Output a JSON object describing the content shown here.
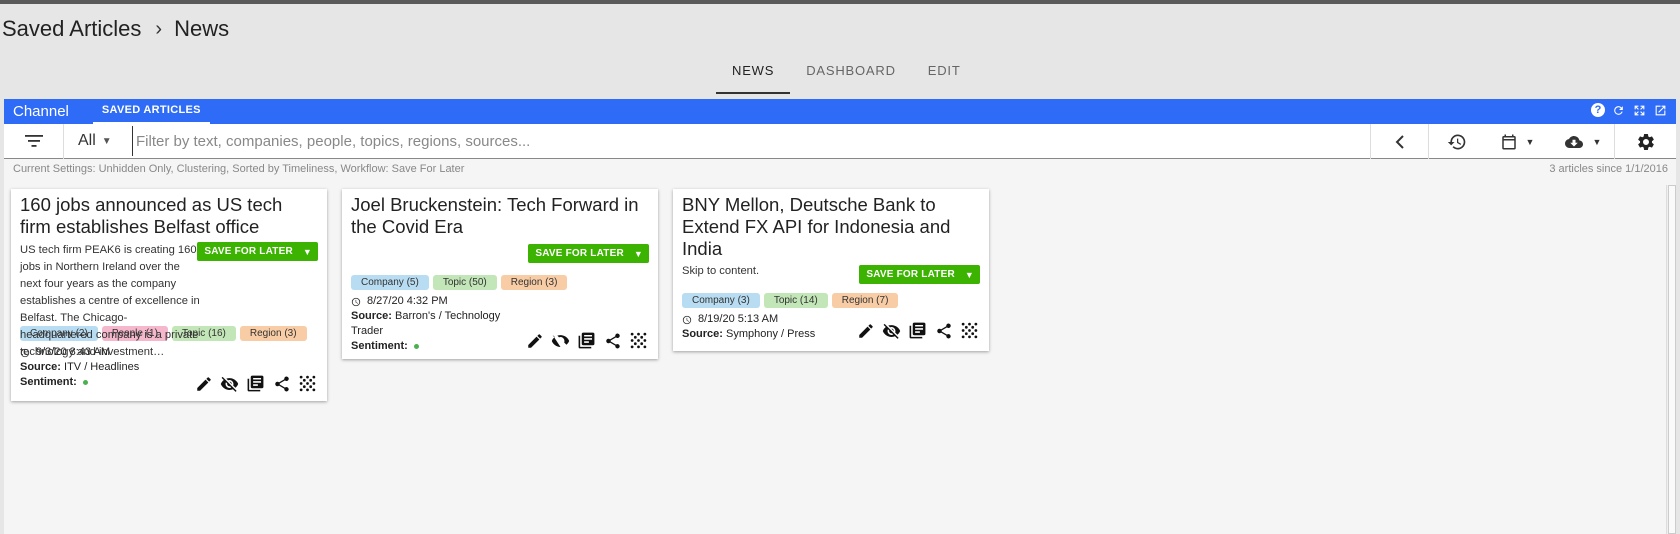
{
  "breadcrumb": {
    "parent": "Saved Articles",
    "separator": "›",
    "current": "News"
  },
  "tabs": [
    {
      "label": "NEWS",
      "active": true
    },
    {
      "label": "DASHBOARD",
      "active": false
    },
    {
      "label": "EDIT",
      "active": false
    }
  ],
  "channel": {
    "title": "Channel",
    "tab": "SAVED ARTICLES",
    "accent_color": "#2e6bf6"
  },
  "filter": {
    "scope": "All",
    "placeholder": "Filter by text, companies, people, topics, regions, sources..."
  },
  "settings_text": "Current Settings: Unhidden Only, Clustering, Sorted by Timeliness, Workflow: Save For Later",
  "articles_count_text": "3 articles since 1/1/2016",
  "save_label": "SAVE FOR LATER",
  "save_color": "#3bb300",
  "articles": [
    {
      "title": "160 jobs announced as US tech firm establishes Belfast office",
      "summary": "US tech firm PEAK6 is creating 160 jobs in Northern Ireland over the next four years as the company establishes a centre of excellence in Belfast. The Chicago-headquartered company is a private technology and investment…",
      "tags": {
        "company": "Company (2)",
        "people": "People (1)",
        "topic": "Topic (16)",
        "region": "Region (3)"
      },
      "date": "9/3/20 8:43 AM",
      "source_label": "Source:",
      "source": "ITV / Headlines",
      "sentiment_label": "Sentiment:"
    },
    {
      "title": "Joel Bruckenstein: Tech Forward in the Covid Era",
      "tags": {
        "company": "Company (5)",
        "topic": "Topic (50)",
        "region": "Region (3)"
      },
      "date": "8/27/20 4:32 PM",
      "source_label": "Source:",
      "source": "Barron's / Technology Trader",
      "sentiment_label": "Sentiment:"
    },
    {
      "title": "BNY Mellon, Deutsche Bank to Extend FX API for Indonesia and India",
      "summary": "Skip to content.",
      "tags": {
        "company": "Company (3)",
        "topic": "Topic (14)",
        "region": "Region (7)"
      },
      "date": "8/19/20 5:13 AM",
      "source_label": "Source:",
      "source": "Symphony / Press"
    }
  ]
}
